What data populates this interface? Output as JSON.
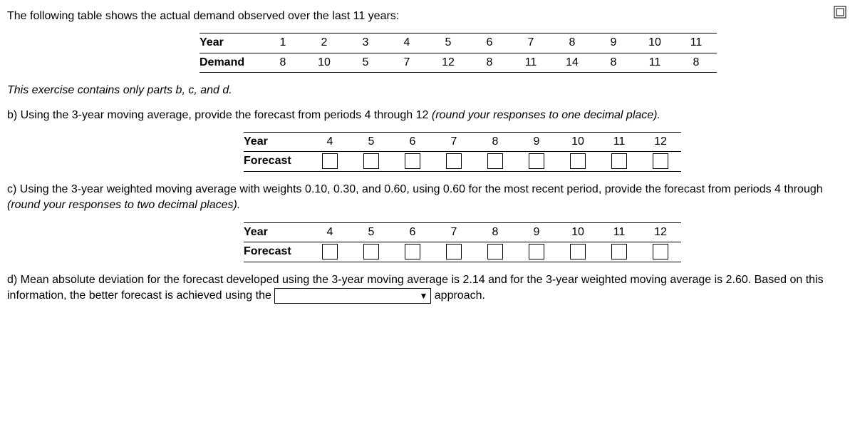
{
  "intro": "The following table shows the actual demand observed over the last 11 years:",
  "data_table": {
    "year_label": "Year",
    "demand_label": "Demand",
    "years": [
      "1",
      "2",
      "3",
      "4",
      "5",
      "6",
      "7",
      "8",
      "9",
      "10",
      "11"
    ],
    "demand": [
      "8",
      "10",
      "5",
      "7",
      "12",
      "8",
      "11",
      "14",
      "8",
      "11",
      "8"
    ]
  },
  "note": "This exercise contains only parts b, c, and d.",
  "part_b": {
    "prompt_lead": "b) Using the 3-year moving average, provide the forecast from periods 4 through 12 ",
    "prompt_tail": "(round your responses to one decimal place).",
    "year_label": "Year",
    "forecast_label": "Forecast",
    "years": [
      "4",
      "5",
      "6",
      "7",
      "8",
      "9",
      "10",
      "11",
      "12"
    ]
  },
  "part_c": {
    "prompt_line1_lead": "c) Using the 3-year weighted moving average with weights 0.10, 0.30, and 0.60, using 0.60 for the most recent period, provide the forecast from periods 4 through",
    "prompt_line2": "(round your responses to two decimal places).",
    "year_label": "Year",
    "forecast_label": "Forecast",
    "years": [
      "4",
      "5",
      "6",
      "7",
      "8",
      "9",
      "10",
      "11",
      "12"
    ]
  },
  "part_d": {
    "line1": "d) Mean absolute deviation for the forecast developed using the 3-year moving average is 2.14 and for the 3-year weighted moving average is 2.60.  Based on this",
    "line2_lead": "information, the better forecast is achieved using the ",
    "line2_tail": " approach."
  },
  "icons": {
    "fullscreen": "fullscreen-icon",
    "dropdown": "▼"
  }
}
